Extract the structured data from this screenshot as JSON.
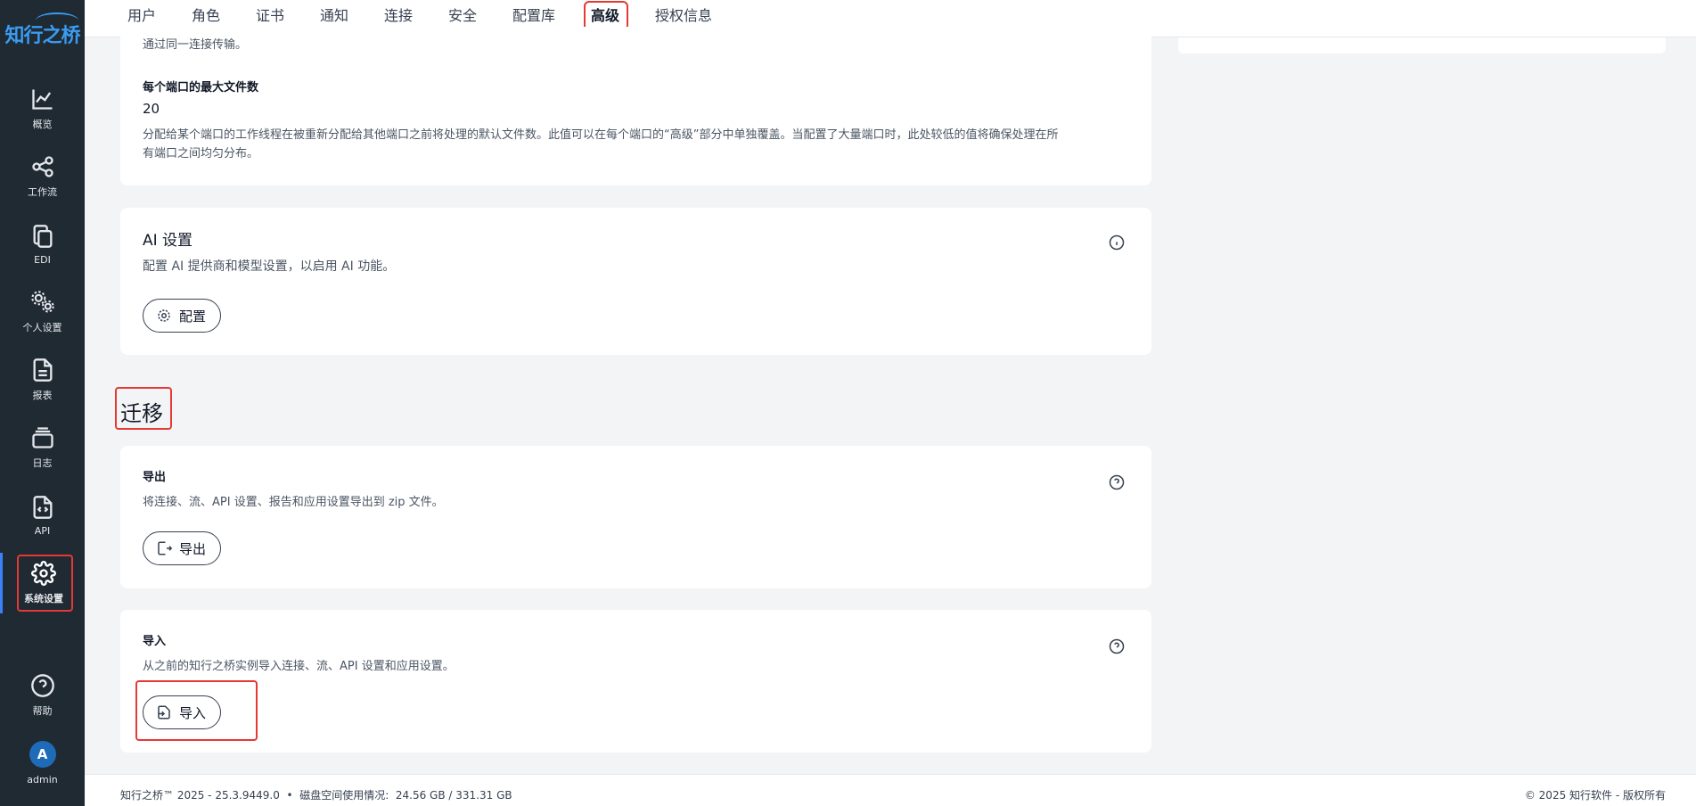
{
  "app": {
    "logo_text": "知行之桥"
  },
  "sidebar": {
    "items": [
      {
        "label": "概览",
        "icon": "chart-line-icon"
      },
      {
        "label": "工作流",
        "icon": "share-nodes-icon"
      },
      {
        "label": "EDI",
        "icon": "copy-icon"
      },
      {
        "label": "个人设置",
        "icon": "gears-icon"
      },
      {
        "label": "报表",
        "icon": "file-text-icon"
      },
      {
        "label": "日志",
        "icon": "layers-icon"
      },
      {
        "label": "API",
        "icon": "file-code-icon"
      },
      {
        "label": "系统设置",
        "icon": "gear-icon",
        "active": true
      }
    ],
    "help_label": "帮助",
    "user": {
      "initial": "A",
      "name": "admin"
    }
  },
  "tabs": [
    {
      "label": "用户"
    },
    {
      "label": "角色"
    },
    {
      "label": "证书"
    },
    {
      "label": "通知"
    },
    {
      "label": "连接"
    },
    {
      "label": "安全"
    },
    {
      "label": "配置库"
    },
    {
      "label": "高级",
      "active": true
    },
    {
      "label": "授权信息"
    }
  ],
  "top_card": {
    "clipped_text": "通过同一连接传输。",
    "max_files_label": "每个端口的最大文件数",
    "max_files_value": "20",
    "max_files_desc_line1": "分配给某个端口的工作线程在被重新分配给其他端口之前将处理的默认文件数。此值可以在每个端口的“高级”部分中单独覆盖。当配置了大量端口时，此处较低的值将确保处理在所",
    "max_files_desc_line2": "有端口之间均匀分布。"
  },
  "ai_card": {
    "title": "AI 设置",
    "desc": "配置 AI 提供商和模型设置，以启用 AI 功能。",
    "button_label": "配置"
  },
  "migration": {
    "section_title": "迁移",
    "export": {
      "title": "导出",
      "desc": "将连接、流、API 设置、报告和应用设置导出到 zip 文件。",
      "button_label": "导出"
    },
    "import": {
      "title": "导入",
      "desc": "从之前的知行之桥实例导入连接、流、API 设置和应用设置。",
      "button_label": "导入"
    }
  },
  "footer": {
    "version": "知行之桥™ 2025 - 25.3.9449.0",
    "separator": "•",
    "disk_label": "磁盘空间使用情况:",
    "disk_value": "24.56 GB / 331.31 GB",
    "copyright": "© 2025 知行软件 - 版权所有"
  },
  "colors": {
    "sidebar_bg": "#1f2a33",
    "accent": "#2563eb",
    "highlight": "#e53935",
    "logo": "#3b9bf0"
  }
}
